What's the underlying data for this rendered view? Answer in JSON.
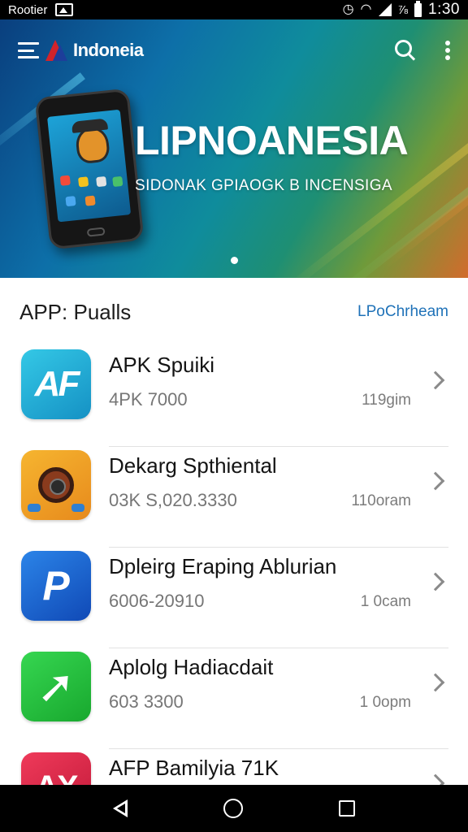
{
  "status_bar": {
    "carrier": "Rootier",
    "battery_percent": "⅞",
    "time": "1:30"
  },
  "app_bar": {
    "title": "Indoneia",
    "icons": [
      "menu-icon",
      "logo-icon",
      "search-icon",
      "more-vert-icon"
    ]
  },
  "banner": {
    "headline": "LIPNOANESIA",
    "subheadline": "SIDONAK GPIAOGK B INCENSIGA",
    "pager_total": 1,
    "pager_active": 1
  },
  "section": {
    "title": "APP: Pualls",
    "link_label": "LPoChrheam"
  },
  "apps": [
    {
      "name": "APK Spuiki",
      "version": "4PK 7000",
      "time": "119gim",
      "icon": "af-icon"
    },
    {
      "name": "Dekarg Spthiental",
      "version": "03K S,020.3330",
      "time": "110oram",
      "icon": "camera-icon"
    },
    {
      "name": "Dpleirg Eraping Ablurian",
      "version": "6006-20910",
      "time": "1 0cam",
      "icon": "p-arrow-icon"
    },
    {
      "name": "Aplolg Hadiacdait",
      "version": "603 3300",
      "time": "1 0opm",
      "icon": "green-arrow-icon"
    },
    {
      "name": "AFP Bamilyia 71K",
      "version": "",
      "time": "",
      "icon": "ax-icon"
    }
  ],
  "nav_bar": {
    "icons": [
      "back-icon",
      "home-icon",
      "recents-icon"
    ]
  },
  "colors": {
    "link": "#1f72b8",
    "status_bar": "#000000",
    "nav_bar": "#000000"
  }
}
